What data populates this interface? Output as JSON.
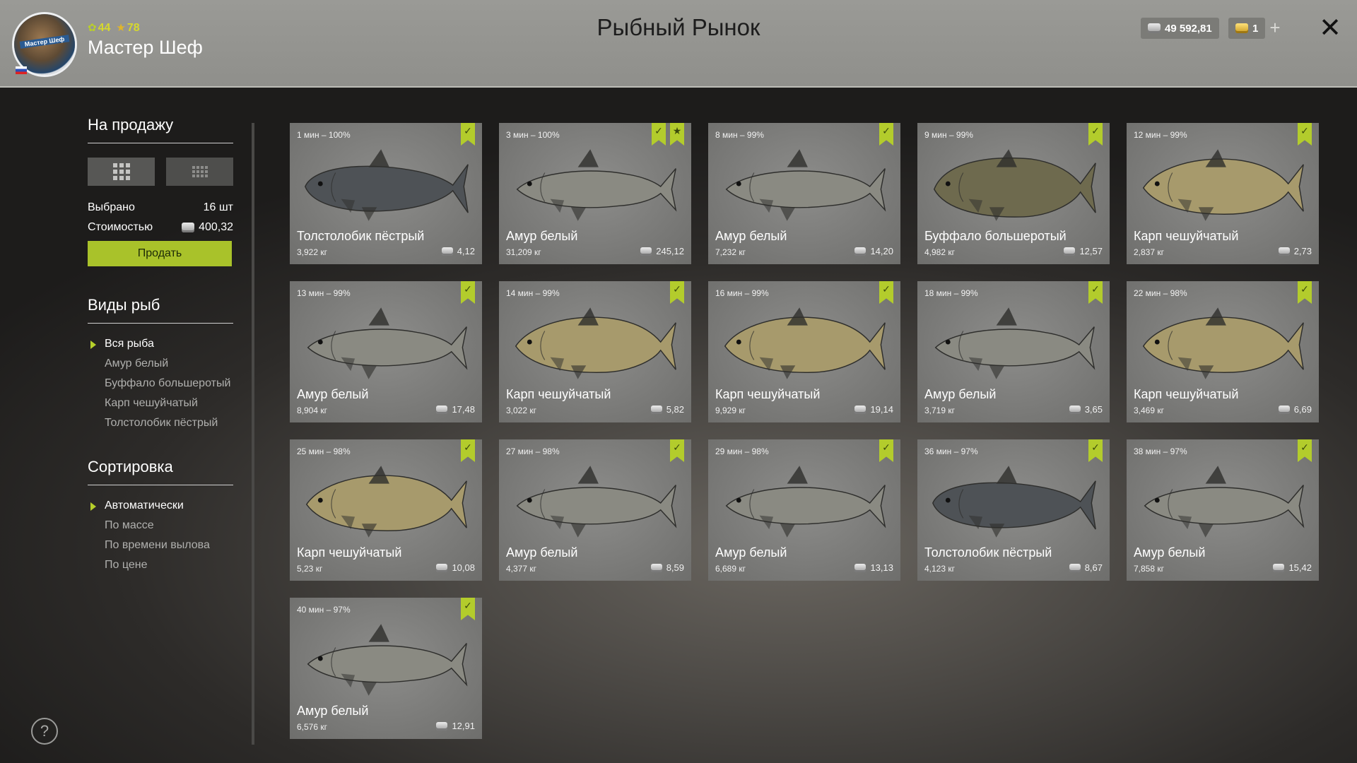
{
  "header": {
    "title": "Рыбный Рынок",
    "player_name": "Мастер Шеф",
    "avatar_label": "Мастер Шеф",
    "level": "44",
    "rating": "78",
    "silver": "49 592,81",
    "gold": "1",
    "add_symbol": "+",
    "close_symbol": "✕"
  },
  "sidebar": {
    "sale_title": "На продажу",
    "selected_label": "Выбрано",
    "selected_value": "16 шт",
    "cost_label": "Стоимостью",
    "cost_value": "400,32",
    "sell_button": "Продать",
    "species_title": "Виды рыб",
    "species": [
      "Вся рыба",
      "Амур белый",
      "Буффало большеротый",
      "Карп чешуйчатый",
      "Толстолобик пёстрый"
    ],
    "sort_title": "Сортировка",
    "sort_options": [
      "Автоматически",
      "По массе",
      "По времени вылова",
      "По цене"
    ],
    "help_symbol": "?"
  },
  "cards": [
    {
      "time": "1 мин – 100%",
      "name": "Толстолобик пёстрый",
      "weight": "3,922 кг",
      "price": "4,12",
      "species": "bighead",
      "favorite": false
    },
    {
      "time": "3 мин – 100%",
      "name": "Амур белый",
      "weight": "31,209 кг",
      "price": "245,12",
      "species": "amur",
      "favorite": true
    },
    {
      "time": "8 мин – 99%",
      "name": "Амур белый",
      "weight": "7,232 кг",
      "price": "14,20",
      "species": "amur",
      "favorite": false
    },
    {
      "time": "9 мин – 99%",
      "name": "Буффало большеротый",
      "weight": "4,982 кг",
      "price": "12,57",
      "species": "buffalo",
      "favorite": false
    },
    {
      "time": "12 мин – 99%",
      "name": "Карп чешуйчатый",
      "weight": "2,837 кг",
      "price": "2,73",
      "species": "carp",
      "favorite": false
    },
    {
      "time": "13 мин – 99%",
      "name": "Амур белый",
      "weight": "8,904 кг",
      "price": "17,48",
      "species": "amur",
      "favorite": false
    },
    {
      "time": "14 мин – 99%",
      "name": "Карп чешуйчатый",
      "weight": "3,022 кг",
      "price": "5,82",
      "species": "carp",
      "favorite": false
    },
    {
      "time": "16 мин – 99%",
      "name": "Карп чешуйчатый",
      "weight": "9,929 кг",
      "price": "19,14",
      "species": "carp",
      "favorite": false
    },
    {
      "time": "18 мин – 99%",
      "name": "Амур белый",
      "weight": "3,719 кг",
      "price": "3,65",
      "species": "amur",
      "favorite": false
    },
    {
      "time": "22 мин – 98%",
      "name": "Карп чешуйчатый",
      "weight": "3,469 кг",
      "price": "6,69",
      "species": "carp",
      "favorite": false
    },
    {
      "time": "25 мин – 98%",
      "name": "Карп чешуйчатый",
      "weight": "5,23 кг",
      "price": "10,08",
      "species": "carp",
      "favorite": false
    },
    {
      "time": "27 мин – 98%",
      "name": "Амур белый",
      "weight": "4,377 кг",
      "price": "8,59",
      "species": "amur",
      "favorite": false
    },
    {
      "time": "29 мин – 98%",
      "name": "Амур белый",
      "weight": "6,689 кг",
      "price": "13,13",
      "species": "amur",
      "favorite": false
    },
    {
      "time": "36 мин – 97%",
      "name": "Толстолобик пёстрый",
      "weight": "4,123 кг",
      "price": "8,67",
      "species": "bighead",
      "favorite": false
    },
    {
      "time": "38 мин – 97%",
      "name": "Амур белый",
      "weight": "7,858 кг",
      "price": "15,42",
      "species": "amur",
      "favorite": false
    },
    {
      "time": "40 мин – 97%",
      "name": "Амур белый",
      "weight": "6,576 кг",
      "price": "12,91",
      "species": "amur",
      "favorite": false
    }
  ],
  "species_colors": {
    "amur": "#8a8a82",
    "carp": "#a79a6c",
    "bighead": "#4e5256",
    "buffalo": "#6e6a4e"
  },
  "colors": {
    "accent": "#a9c22a",
    "mark": "#b3cc2c"
  }
}
